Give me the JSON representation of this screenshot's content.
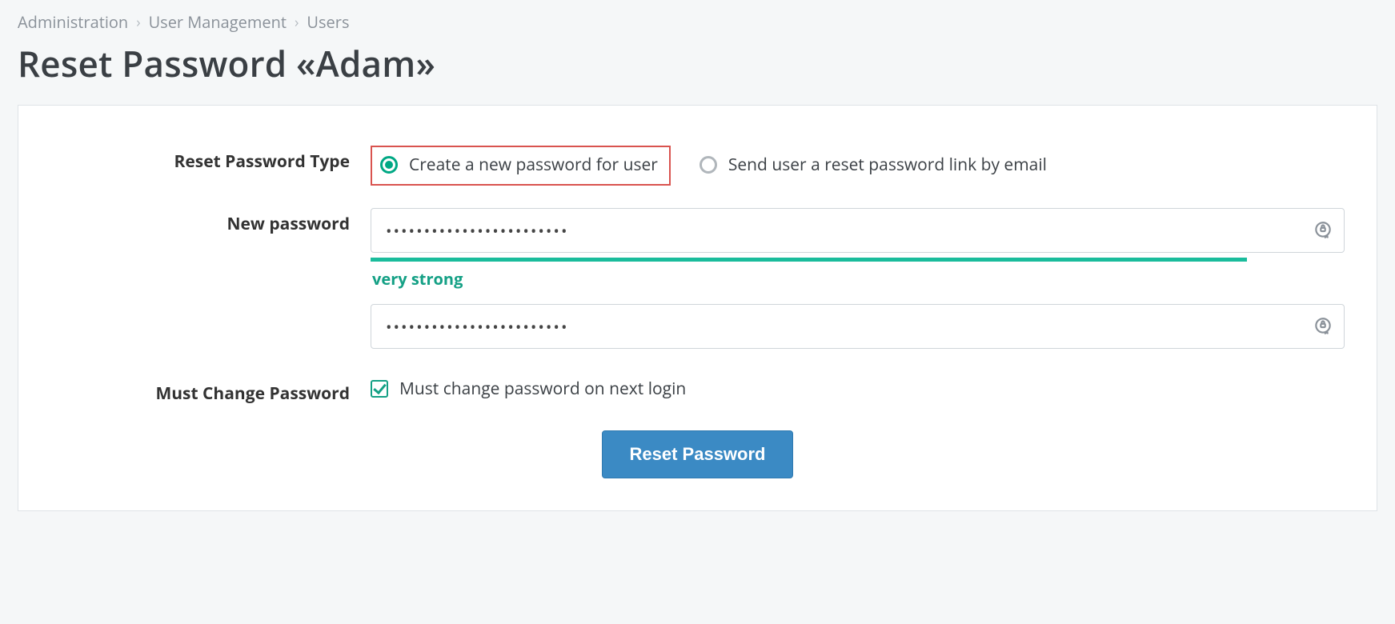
{
  "breadcrumb": {
    "items": [
      "Administration",
      "User Management",
      "Users"
    ]
  },
  "page_title": "Reset Password «Adam»",
  "form": {
    "reset_type": {
      "label": "Reset Password Type",
      "option_create": "Create a new password for user",
      "option_email": "Send user a reset password link by email",
      "selected": "create"
    },
    "new_password": {
      "label": "New password",
      "value": "••••••••••••••••••••••••",
      "confirm_value": "••••••••••••••••••••••••",
      "strength_text": "very strong"
    },
    "must_change": {
      "label": "Must Change Password",
      "checkbox_label": "Must change password on next login",
      "checked": true
    },
    "submit_label": "Reset Password"
  }
}
